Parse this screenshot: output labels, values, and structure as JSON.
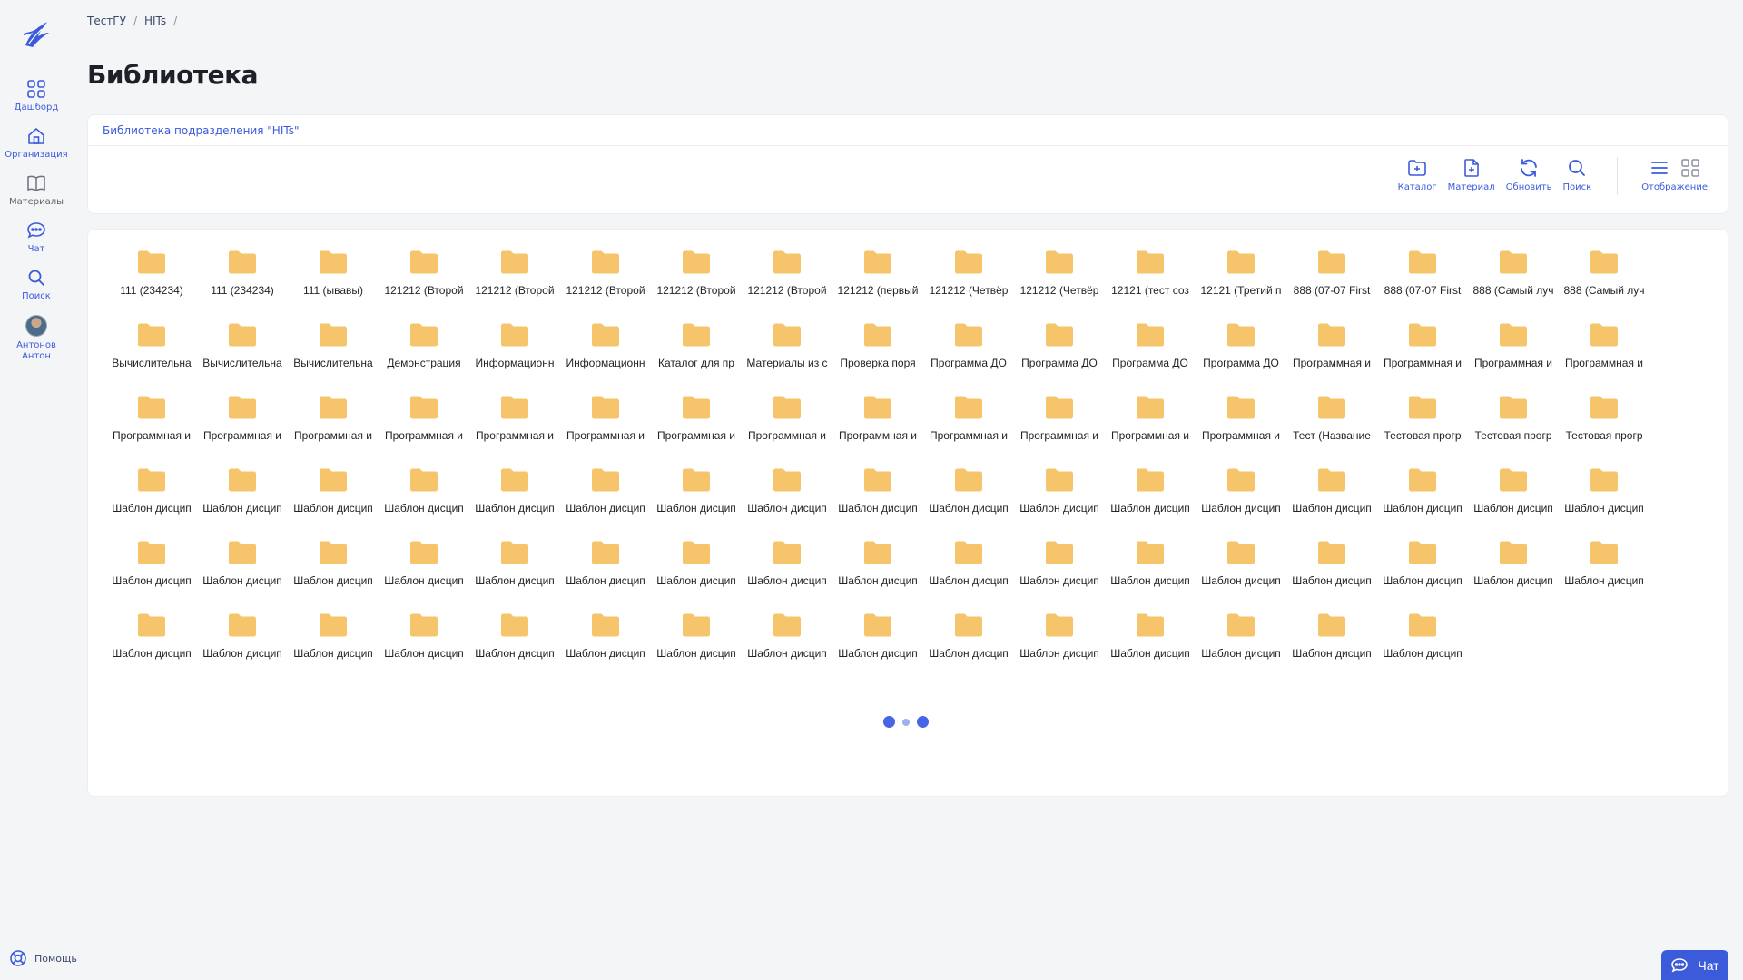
{
  "colors": {
    "accent": "#3b5bdb",
    "folder": "#f6c46a",
    "background": "#f4f5f7"
  },
  "sidebar": {
    "items": [
      {
        "label": "Дашборд",
        "icon": "grid-icon"
      },
      {
        "label": "Организация",
        "icon": "home-icon"
      },
      {
        "label": "Материалы",
        "icon": "book-icon"
      },
      {
        "label": "Чат",
        "icon": "chat-icon"
      },
      {
        "label": "Поиск",
        "icon": "search-icon"
      }
    ],
    "user": {
      "name_line1": "Антонов",
      "name_line2": "Антон"
    },
    "help_label": "Помощь"
  },
  "breadcrumb": {
    "items": [
      "ТестГУ",
      "HITs"
    ],
    "separator": "/"
  },
  "page_title": "Библиотека",
  "tab_label": "Библиотека подразделения \"HITs\"",
  "toolbar": {
    "catalog": "Каталог",
    "material": "Материал",
    "refresh": "Обновить",
    "search": "Поиск",
    "view": "Отображение"
  },
  "items": [
    "111 (234234)",
    "111 (234234)",
    "111 (ывавы)",
    "121212 (Второй",
    "121212 (Второй",
    "121212 (Второй",
    "121212 (Второй",
    "121212 (Второй",
    "121212 (первый",
    "121212 (Четвёр",
    "121212 (Четвёр",
    "12121 (тест соз",
    "12121 (Третий п",
    "888 (07-07 First",
    "888 (07-07 First",
    "888 (Самый луч",
    "888 (Самый луч",
    "Вычислительна",
    "Вычислительна",
    "Вычислительна",
    "Демонстрация",
    "Информационн",
    "Информационн",
    "Каталог для пр",
    "Материалы из с",
    "Проверка поря",
    "Программа ДО",
    "Программа ДО",
    "Программа ДО",
    "Программа ДО",
    "Программная и",
    "Программная и",
    "Программная и",
    "Программная и",
    "Программная и",
    "Программная и",
    "Программная и",
    "Программная и",
    "Программная и",
    "Программная и",
    "Программная и",
    "Программная и",
    "Программная и",
    "Программная и",
    "Программная и",
    "Программная и",
    "Программная и",
    "Тест (Название",
    "Тестовая прогр",
    "Тестовая прогр",
    "Тестовая прогр",
    "Шаблон дисцип",
    "Шаблон дисцип",
    "Шаблон дисцип",
    "Шаблон дисцип",
    "Шаблон дисцип",
    "Шаблон дисцип",
    "Шаблон дисцип",
    "Шаблон дисцип",
    "Шаблон дисцип",
    "Шаблон дисцип",
    "Шаблон дисцип",
    "Шаблон дисцип",
    "Шаблон дисцип",
    "Шаблон дисцип",
    "Шаблон дисцип",
    "Шаблон дисцип",
    "Шаблон дисцип",
    "Шаблон дисцип",
    "Шаблон дисцип",
    "Шаблон дисцип",
    "Шаблон дисцип",
    "Шаблон дисцип",
    "Шаблон дисцип",
    "Шаблон дисцип",
    "Шаблон дисцип",
    "Шаблон дисцип",
    "Шаблон дисцип",
    "Шаблон дисцип",
    "Шаблон дисцип",
    "Шаблон дисцип",
    "Шаблон дисцип",
    "Шаблон дисцип",
    "Шаблон дисцип",
    "Шаблон дисцип",
    "Шаблон дисцип",
    "Шаблон дисцип",
    "Шаблон дисцип",
    "Шаблон дисцип",
    "Шаблон дисцип",
    "Шаблон дисцип",
    "Шаблон дисцип",
    "Шаблон дисцип",
    "Шаблон дисцип",
    "Шаблон дисцип",
    "Шаблон дисцип",
    "Шаблон дисцип",
    "Шаблон дисцип",
    "Шаблон дисцип",
    "Шаблон дисцип"
  ],
  "chat_button_label": "Чат"
}
